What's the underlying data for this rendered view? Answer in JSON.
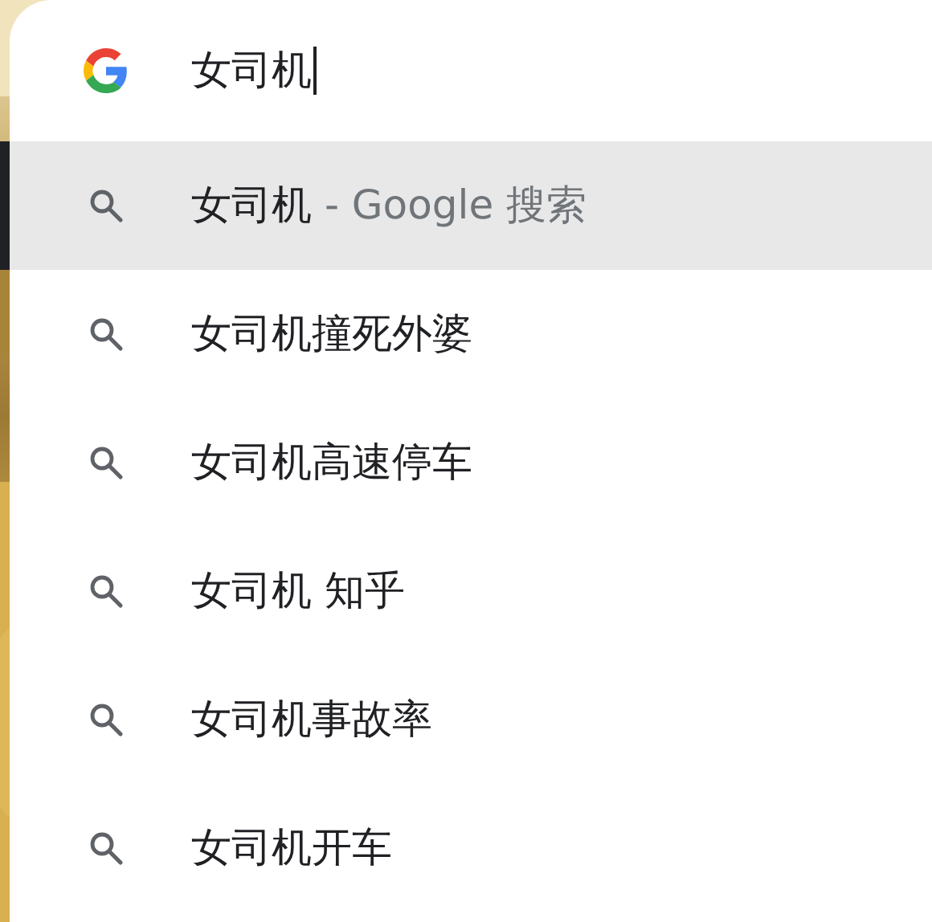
{
  "search_box": {
    "value": "女司机"
  },
  "suggestions": [
    {
      "text": "女司机",
      "suffix": " - Google 搜索",
      "selected": true
    },
    {
      "text": "女司机撞死外婆",
      "selected": false
    },
    {
      "text": "女司机高速停车",
      "selected": false
    },
    {
      "text": "女司机 知乎",
      "selected": false
    },
    {
      "text": "女司机事故率",
      "selected": false
    },
    {
      "text": "女司机开车",
      "selected": false
    }
  ]
}
